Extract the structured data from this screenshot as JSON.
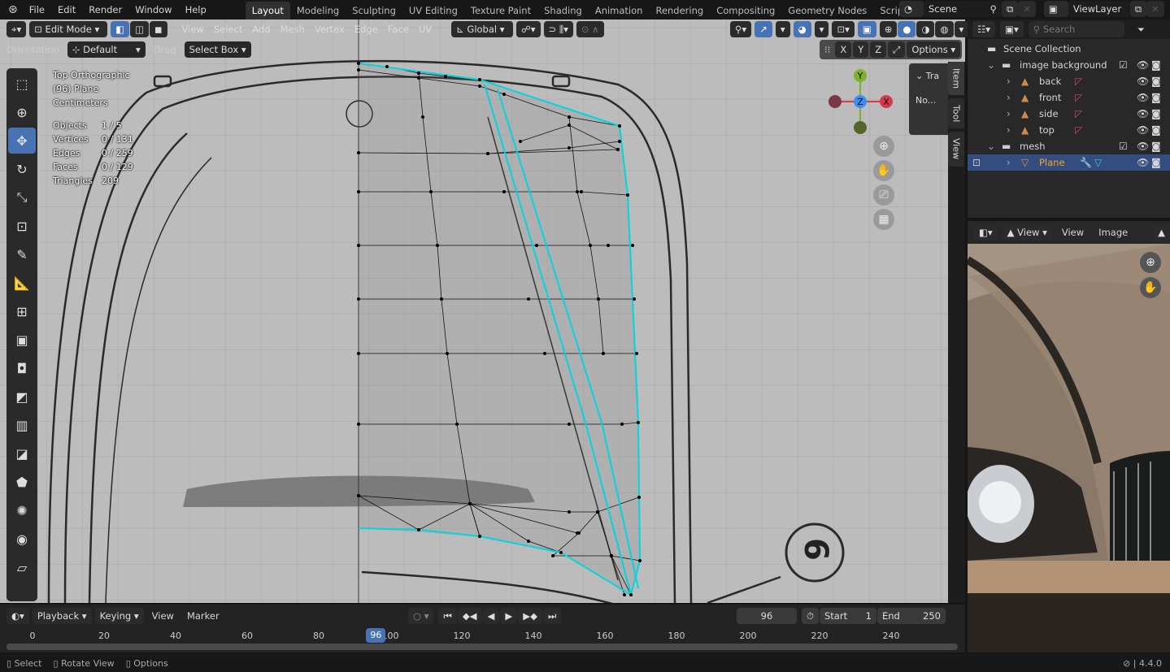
{
  "topbar": {
    "menus": [
      "File",
      "Edit",
      "Render",
      "Window",
      "Help"
    ],
    "workspaces": [
      "Layout",
      "Modeling",
      "Sculpting",
      "UV Editing",
      "Texture Paint",
      "Shading",
      "Animation",
      "Rendering",
      "Compositing",
      "Geometry Nodes",
      "Scripting"
    ],
    "active_workspace": "Layout",
    "scene": "Scene",
    "view_layer": "ViewLayer"
  },
  "viewport": {
    "mode": "Edit Mode",
    "menus": [
      "View",
      "Select",
      "Add",
      "Mesh",
      "Vertex",
      "Edge",
      "Face",
      "UV"
    ],
    "transform_orientation": "Global",
    "orientation_label": "Orientation:",
    "orientation_value": "Default",
    "drag_label": "Drag:",
    "drag_value": "Select Box",
    "axes": [
      "X",
      "Y",
      "Z"
    ],
    "options": "Options",
    "overlay": {
      "view": "Top Orthographic",
      "object": "(96) Plane",
      "units": "Centimeters",
      "stats": [
        {
          "label": "Objects",
          "value": "1 / 5"
        },
        {
          "label": "Vertices",
          "value": "0 / 131"
        },
        {
          "label": "Edges",
          "value": "0 / 259"
        },
        {
          "label": "Faces",
          "value": "0 / 129"
        },
        {
          "label": "Triangles",
          "value": "209"
        }
      ]
    },
    "gizmo": {
      "y": "Y",
      "z": "Z",
      "x": "X"
    },
    "npanel": {
      "section": "Tra",
      "content": "No...",
      "tabs": [
        "Item",
        "Tool",
        "View"
      ]
    },
    "mesh_color": "#00d5e0",
    "blueprint_label": "6"
  },
  "outliner": {
    "search_placeholder": "Search",
    "root": "Scene Collection",
    "items": [
      {
        "name": "image background",
        "level": 1,
        "type": "collection"
      },
      {
        "name": "back",
        "level": 2,
        "type": "image"
      },
      {
        "name": "front",
        "level": 2,
        "type": "image"
      },
      {
        "name": "side",
        "level": 2,
        "type": "image"
      },
      {
        "name": "top",
        "level": 2,
        "type": "image"
      },
      {
        "name": "mesh",
        "level": 1,
        "type": "collection"
      },
      {
        "name": "Plane",
        "level": 2,
        "type": "mesh",
        "selected": true
      }
    ]
  },
  "image_editor": {
    "view_menu": "View",
    "menus": [
      "View",
      "Image"
    ]
  },
  "timeline": {
    "menus": [
      "Playback",
      "Keying",
      "View",
      "Marker"
    ],
    "current_frame": 96,
    "start_label": "Start",
    "start": 1,
    "end_label": "End",
    "end": 250,
    "ticks": [
      0,
      20,
      40,
      60,
      80,
      100,
      120,
      140,
      160,
      180,
      200,
      220,
      240
    ]
  },
  "statusbar": {
    "hints": [
      "Select",
      "Rotate View",
      "Options"
    ],
    "version": "4.4.0"
  }
}
